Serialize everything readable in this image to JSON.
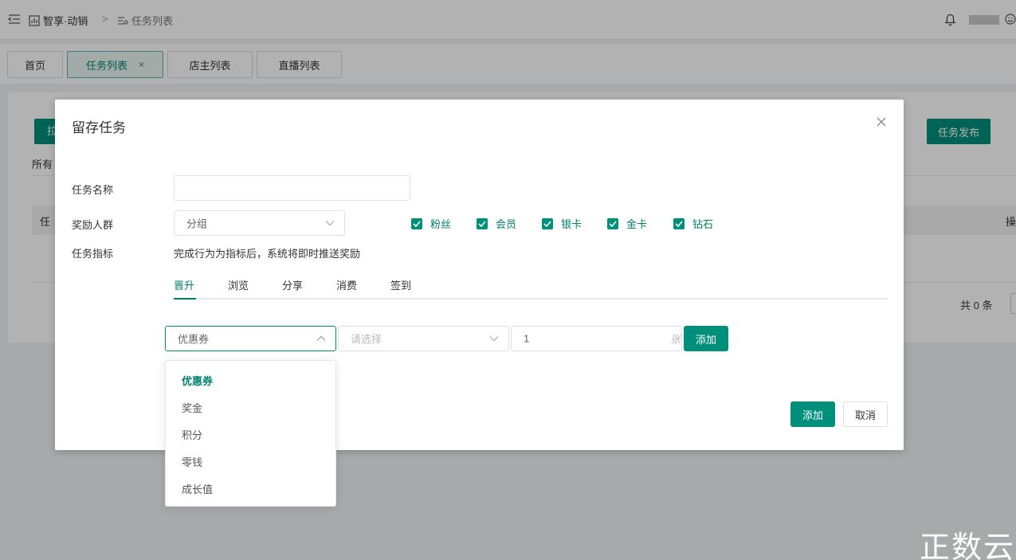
{
  "header": {
    "breadcrumb_home": "智享·动销",
    "breadcrumb_sep": ">",
    "breadcrumb_current": "任务列表"
  },
  "tabs": [
    {
      "label": "首页"
    },
    {
      "label": "任务列表",
      "close": "×"
    },
    {
      "label": "店主列表"
    },
    {
      "label": "直播列表"
    }
  ],
  "page": {
    "left_button": "拉",
    "publish_button": "任务发布",
    "filter_all": "所有",
    "table_head_left": "任",
    "table_head_right": "操",
    "total": "共 0 条"
  },
  "modal": {
    "title": "留存任务",
    "name_label": "任务名称",
    "name_value": "",
    "crowd_label": "奖励人群",
    "group_select": "分组",
    "checkboxes": [
      "粉丝",
      "会员",
      "银卡",
      "金卡",
      "钻石"
    ],
    "indicator_label": "任务指标",
    "indicator_hint": "完成行为为指标后，系统将即时推送奖励",
    "subtabs": [
      "晋升",
      "浏览",
      "分享",
      "消费",
      "签到"
    ],
    "reward_type": "优惠券",
    "reward_item_placeholder": "请选择",
    "quantity": "1",
    "unit": "张",
    "add_row_button": "添加",
    "confirm_button": "添加",
    "cancel_button": "取消"
  },
  "dropdown": {
    "options": [
      "优惠券",
      "奖金",
      "积分",
      "零钱",
      "成长值"
    ],
    "selected": "优惠券"
  },
  "watermark": "正数云",
  "colors": {
    "accent": "#008f7a",
    "accent_text": "#00806b"
  }
}
